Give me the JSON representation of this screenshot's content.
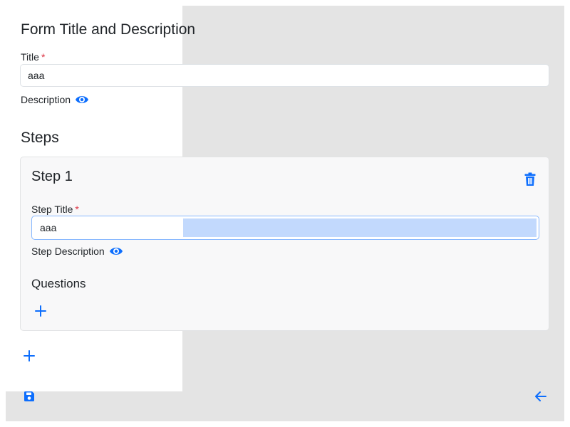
{
  "form": {
    "heading": "Form Title and Description",
    "title_label": "Title",
    "required_mark": "*",
    "title_value": "aaa",
    "description_label": "Description"
  },
  "steps": {
    "heading": "Steps",
    "items": [
      {
        "title": "Step 1",
        "step_title_label": "Step Title",
        "step_title_value": "aaa",
        "step_description_label": "Step Description",
        "questions_heading": "Questions"
      }
    ]
  },
  "icons": {
    "eye": "eye-icon",
    "trash": "trash-icon",
    "plus": "plus-icon",
    "save": "floppy-disk-icon",
    "back": "arrow-left-icon"
  },
  "colors": {
    "accent": "#0d6efd",
    "required": "#dc3545",
    "background_gray": "#e4e4e4",
    "card_bg": "#f8f8f9",
    "selection": "#c2d9fd"
  }
}
